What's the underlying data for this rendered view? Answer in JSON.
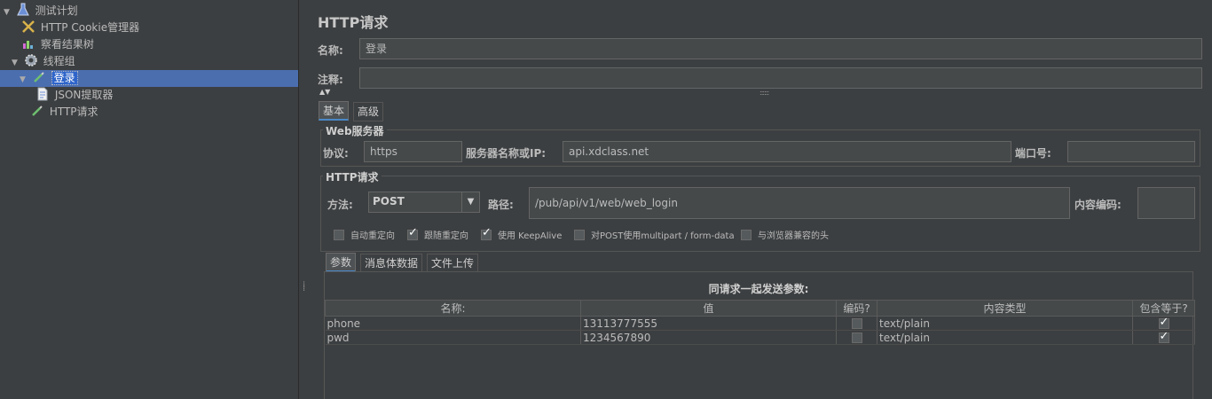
{
  "tree": {
    "items": [
      {
        "label": "测试计划",
        "icon": "flask-icon"
      },
      {
        "label": "HTTP Cookie管理器",
        "icon": "tools-icon"
      },
      {
        "label": "察看结果树",
        "icon": "chart-icon"
      },
      {
        "label": "线程组",
        "icon": "gear-icon"
      },
      {
        "label": "登录",
        "icon": "pipette-icon"
      },
      {
        "label": "JSON提取器",
        "icon": "document-icon"
      },
      {
        "label": "HTTP请求",
        "icon": "pipette-icon"
      }
    ]
  },
  "panel": {
    "title": "HTTP请求",
    "name_label": "名称:",
    "name_value": "登录",
    "comment_label": "注释:",
    "comment_value": ""
  },
  "tabs": {
    "basic": "基本",
    "advanced": "高级"
  },
  "web_server": {
    "title": "Web服务器",
    "protocol_label": "协议:",
    "protocol_value": "https",
    "server_label": "服务器名称或IP:",
    "server_value": "api.xdclass.net",
    "port_label": "端口号:",
    "port_value": ""
  },
  "http_request": {
    "title": "HTTP请求",
    "method_label": "方法:",
    "method_value": "POST",
    "path_label": "路径:",
    "path_value": "/pub/api/v1/web/web_login",
    "encoding_label": "内容编码:",
    "encoding_value": ""
  },
  "options": [
    {
      "label": "自动重定向",
      "checked": false
    },
    {
      "label": "跟随重定向",
      "checked": true
    },
    {
      "label": "使用 KeepAlive",
      "checked": true
    },
    {
      "label": "对POST使用multipart / form-data",
      "checked": false
    },
    {
      "label": "与浏览器兼容的头",
      "checked": false
    }
  ],
  "subtabs": {
    "params": "参数",
    "body": "消息体数据",
    "files": "文件上传"
  },
  "params": {
    "caption": "同请求一起发送参数:",
    "columns": [
      "名称:",
      "值",
      "编码?",
      "内容类型",
      "包含等于?"
    ],
    "rows": [
      {
        "name": "phone",
        "value": "13113777555",
        "encode": false,
        "content_type": "text/plain",
        "include_equals": true
      },
      {
        "name": "pwd",
        "value": "1234567890",
        "encode": false,
        "content_type": "text/plain",
        "include_equals": true
      }
    ]
  }
}
